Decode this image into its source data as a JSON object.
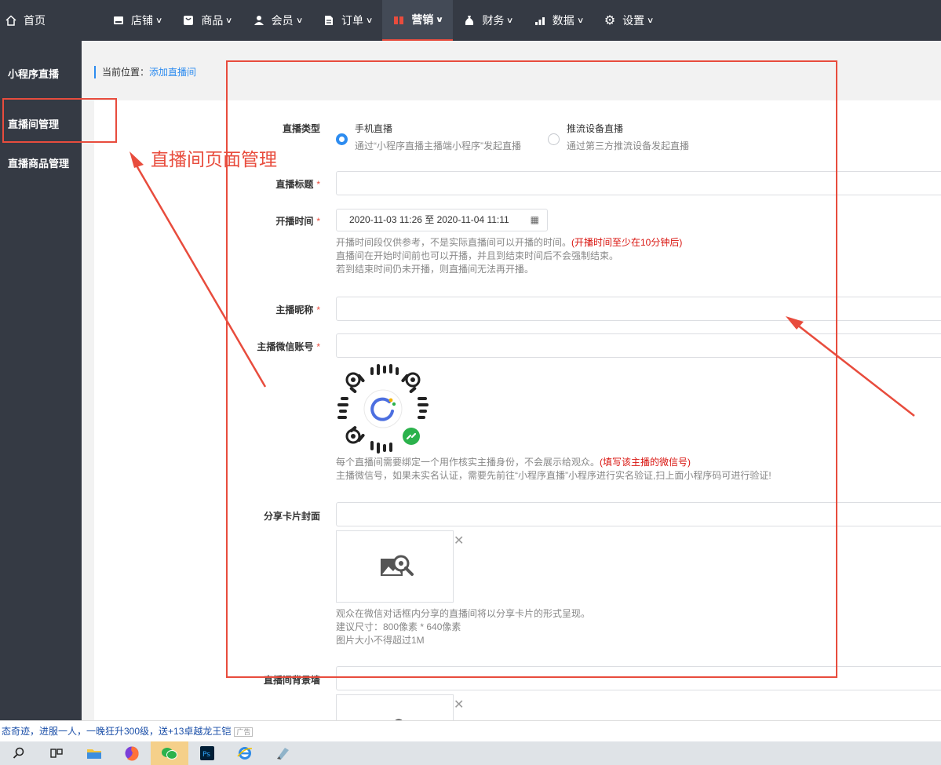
{
  "topnav": {
    "home": "首页",
    "items": [
      {
        "label": "店铺",
        "icon": "store-icon"
      },
      {
        "label": "商品",
        "icon": "goods-icon"
      },
      {
        "label": "会员",
        "icon": "user-icon"
      },
      {
        "label": "订单",
        "icon": "order-icon"
      },
      {
        "label": "营销",
        "icon": "gift-icon",
        "active": true
      },
      {
        "label": "财务",
        "icon": "money-bag-icon"
      },
      {
        "label": "数据",
        "icon": "chart-icon"
      },
      {
        "label": "设置",
        "icon": "gear-icon"
      }
    ]
  },
  "sidebar": {
    "items": [
      {
        "label": "小程序直播"
      },
      {
        "label": "直播间管理",
        "active": true
      },
      {
        "label": "直播商品管理"
      }
    ]
  },
  "breadcrumb": {
    "prefix": "当前位置：",
    "current": "添加直播间"
  },
  "form": {
    "live_type": {
      "label": "直播类型",
      "options": [
        {
          "title": "手机直播",
          "desc": "通过“小程序直播主播端小程序”发起直播",
          "checked": true
        },
        {
          "title": "推流设备直播",
          "desc": "通过第三方推流设备发起直播",
          "checked": false
        }
      ]
    },
    "title": {
      "label": "直播标题",
      "required": "*",
      "value": ""
    },
    "time": {
      "label": "开播时间",
      "required": "*",
      "value": "2020-11-03 11:26 至 2020-11-04 11:11",
      "help1": "开播时间段仅供参考，不是实际直播间可以开播的时间。",
      "help1_red": "(开播时间至少在10分钟后)",
      "help2": "直播间在开始时间前也可以开播，并且到结束时间后不会强制结束。",
      "help3": "若到结束时间仍未开播，则直播间无法再开播。"
    },
    "nickname": {
      "label": "主播昵称",
      "required": "*",
      "value": ""
    },
    "wechat": {
      "label": "主播微信账号",
      "required": "*",
      "value": "",
      "help1": "每个直播间需要绑定一个用作核实主播身份，不会展示给观众。",
      "help1_red": "(填写该主播的微信号)",
      "help2": "主播微信号，如果未实名认证，需要先前往“小程序直播”小程序进行实名验证,扫上面小程序码可进行验证!"
    },
    "cover": {
      "label": "分享卡片封面",
      "help1": "观众在微信对话框内分享的直播间将以分享卡片的形式呈现。",
      "help2": "建议尺寸：800像素 * 640像素",
      "help3": "图片大小不得超过1M"
    },
    "background": {
      "label": "直播间背景墙"
    }
  },
  "annotation": {
    "text": "直播间页面管理",
    "color": "#e84c3d"
  },
  "ticker": {
    "text": "态奇迹，进服一人，一晚狂升300级，送+13卓越龙王铠",
    "tag": "广告"
  },
  "colors": {
    "nav_bg": "#353a44",
    "accent": "#2d8cf0",
    "annotation": "#e84c3d"
  }
}
